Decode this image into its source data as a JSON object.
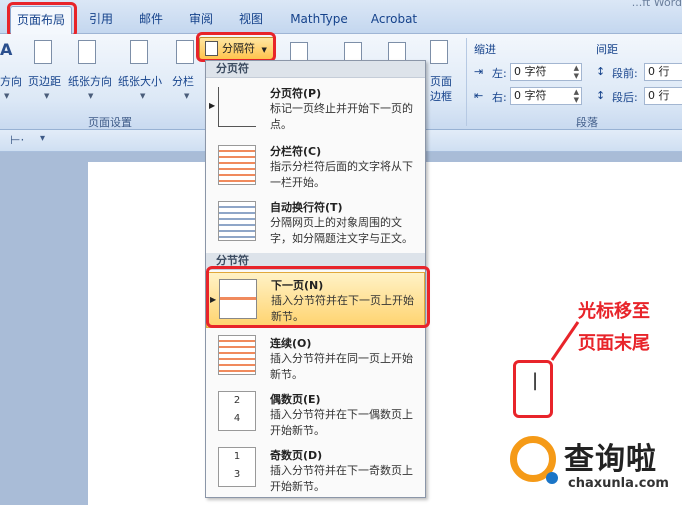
{
  "window": {
    "title_fragment": "...ft Word"
  },
  "tabs": [
    {
      "label": "页面布局",
      "active": true
    },
    {
      "label": "引用"
    },
    {
      "label": "邮件"
    },
    {
      "label": "审阅"
    },
    {
      "label": "视图"
    },
    {
      "label": "MathType"
    },
    {
      "label": "Acrobat"
    }
  ],
  "ribbon": {
    "page_setup": {
      "buttons": [
        "方向",
        "页边距",
        "纸张方向",
        "纸张大小",
        "分栏"
      ],
      "group_label": "页面设置"
    },
    "breaks_button": "分隔符",
    "page_border": [
      "页面",
      "边框"
    ],
    "indent": {
      "label": "缩进",
      "left_label": "左:",
      "left_value": "0 字符",
      "right_label": "右:",
      "right_value": "0 字符"
    },
    "spacing": {
      "label": "间距",
      "before_label": "段前:",
      "before_value": "0 行",
      "after_label": "段后:",
      "after_value": "0 行"
    },
    "paragraph_group_label": "段落"
  },
  "menu": {
    "section_page_breaks": "分页符",
    "section_section_breaks": "分节符",
    "items": [
      {
        "title": "分页符(P)",
        "desc": "标记一页终止并开始下一页的点。"
      },
      {
        "title": "分栏符(C)",
        "desc": "指示分栏符后面的文字将从下一栏开始。"
      },
      {
        "title": "自动换行符(T)",
        "desc": "分隔网页上的对象周围的文字，如分隔题注文字与正文。"
      },
      {
        "title": "下一页(N)",
        "desc": "插入分节符并在下一页上开始新节。",
        "highlighted": true
      },
      {
        "title": "连续(O)",
        "desc": "插入分节符并在同一页上开始新节。"
      },
      {
        "title": "偶数页(E)",
        "desc": "插入分节符并在下一偶数页上开始新节。"
      },
      {
        "title": "奇数页(D)",
        "desc": "插入分节符并在下一奇数页上开始新节。"
      }
    ]
  },
  "annotation": {
    "line1": "光标移至",
    "line2": "页面末尾"
  },
  "watermark": {
    "text": "查询啦",
    "url": "chaxunla.com"
  },
  "colors": {
    "highlight_red": "#e8242a",
    "menu_highlight": "#ffd36e",
    "ribbon_text": "#15428b"
  }
}
